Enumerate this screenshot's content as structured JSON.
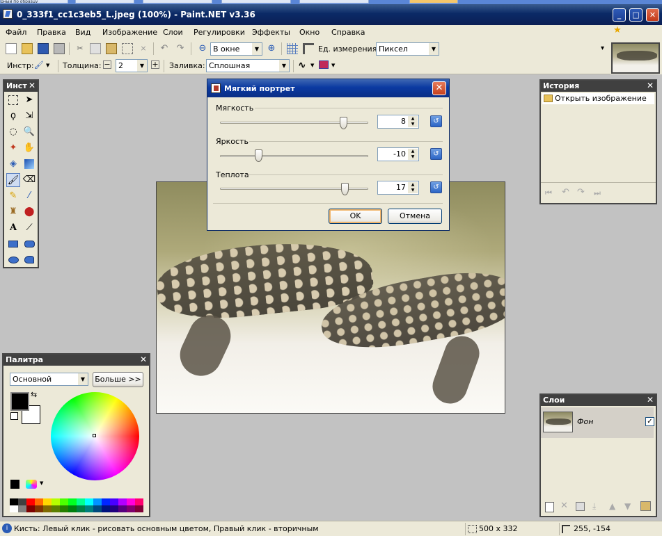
{
  "window": {
    "title": "0_333f1_cc1c3eb5_L.jpeg (100%) - Paint.NET v3.36",
    "top_strip_text": "рный по образцу"
  },
  "menu": [
    "Файл",
    "Правка",
    "Вид",
    "Изображение",
    "Слои",
    "Регулировки",
    "Эффекты",
    "Окно",
    "Справка"
  ],
  "toolbar1": {
    "zoom_value": "В окне",
    "units_label": "Ед. измерения:",
    "units_value": "Пиксел"
  },
  "toolbar2": {
    "tool_label": "Инстр:",
    "thickness_label": "Толщина:",
    "thickness_value": "2",
    "fill_label": "Заливка:",
    "fill_value": "Сплошная"
  },
  "tools_panel": {
    "title": "Инст",
    "close": "✕"
  },
  "dialog": {
    "title": "Мягкий портрет",
    "close": "✕",
    "softness_label": "Мягкость",
    "softness_value": "8",
    "softness_level": 0.83,
    "brightness_label": "Яркость",
    "brightness_value": "-10",
    "brightness_level": 0.26,
    "warmth_label": "Теплота",
    "warmth_value": "17",
    "warmth_level": 0.84,
    "ok_label": "OK",
    "cancel_label": "Отмена"
  },
  "history_panel": {
    "title": "История",
    "close": "✕",
    "item": "Открыть изображение"
  },
  "palette_panel": {
    "title": "Палитра",
    "close": "✕",
    "mode_value": "Основной",
    "more_button": "Больше >>",
    "primary_color": "#000000",
    "secondary_color": "#ffffff",
    "swatches_row1": [
      "#000000",
      "#404040",
      "#ff0000",
      "#ff6a00",
      "#ffd800",
      "#b6ff00",
      "#4cff00",
      "#00ff21",
      "#00ff90",
      "#00ffff",
      "#0094ff",
      "#0026ff",
      "#4800ff",
      "#b200ff",
      "#ff00dc",
      "#ff006e"
    ],
    "swatches_row2": [
      "#ffffff",
      "#808080",
      "#7f0000",
      "#7f3300",
      "#7f6a00",
      "#5b7f00",
      "#267f00",
      "#007f0e",
      "#007f46",
      "#007f7f",
      "#004a7f",
      "#00137f",
      "#21007f",
      "#57007f",
      "#7f006e",
      "#7f0037"
    ]
  },
  "layers_panel": {
    "title": "Слои",
    "close": "✕",
    "layer_name": "Фон",
    "layer_visible": true
  },
  "statusbar": {
    "hint": "Кисть: Левый клик - рисовать основным цветом, Правый клик - вторичным",
    "image_size": "500 x 332",
    "cursor_pos": "255, -154"
  }
}
